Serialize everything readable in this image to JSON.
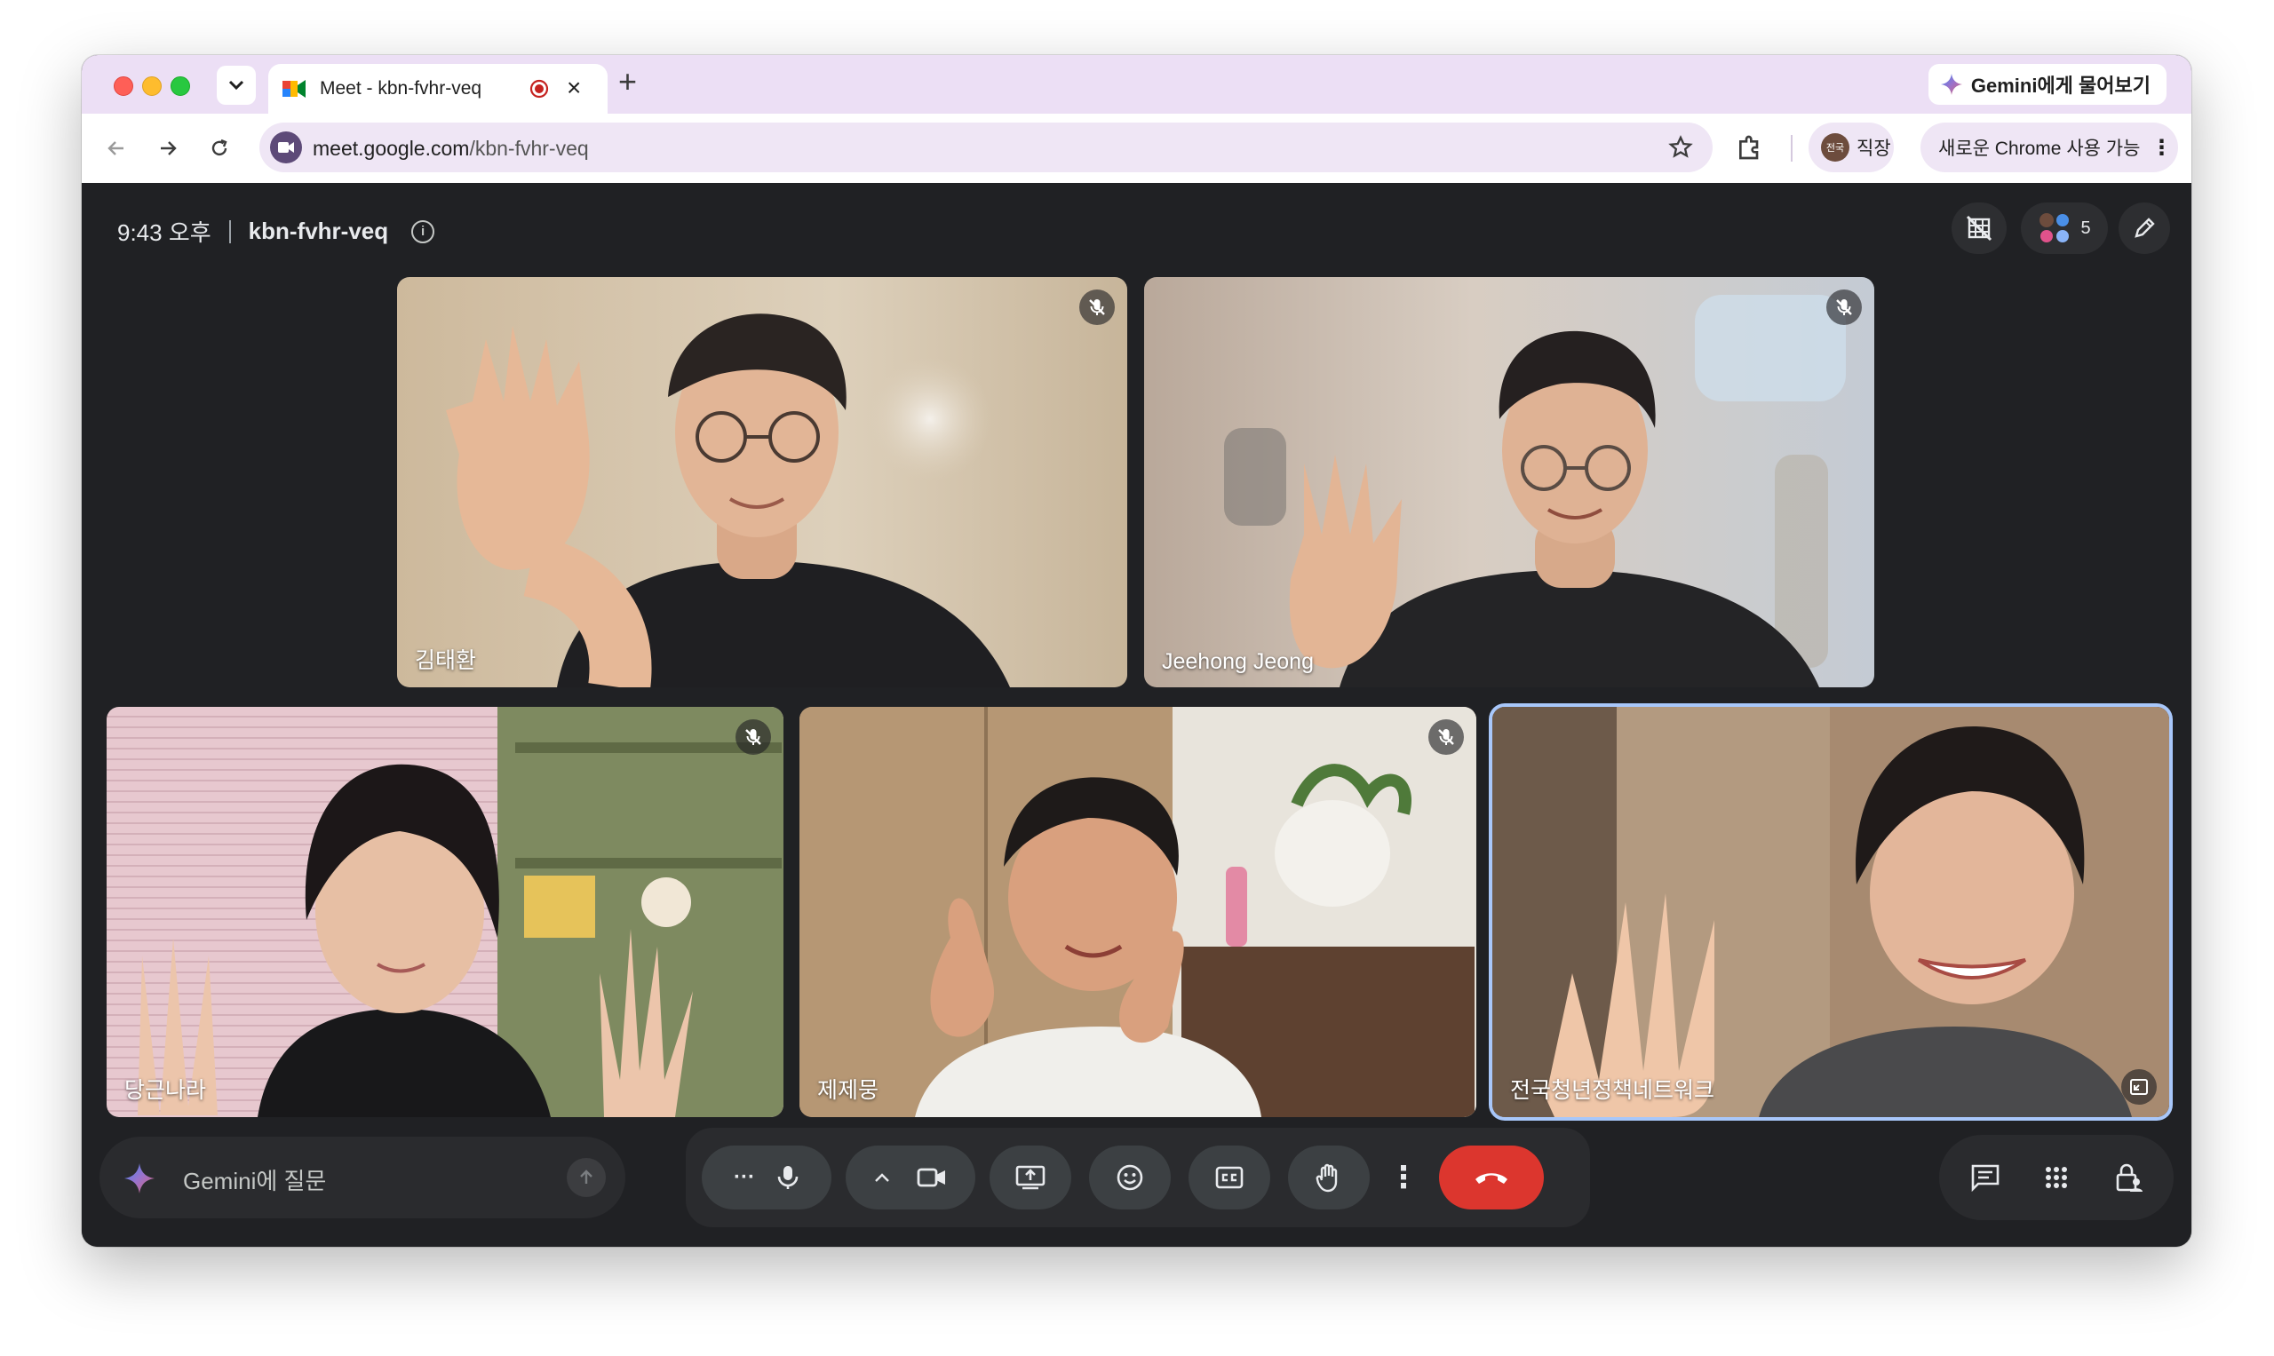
{
  "browser": {
    "tab_title": "Meet - kbn-fvhr-veq",
    "gemini_chip_label": "Gemini에게 물어보기",
    "url_host": "meet.google.com",
    "url_path": "/kbn-fvhr-veq",
    "profile_label": "직장",
    "profile_avatar_text": "전국",
    "update_label": "새로운 Chrome 사용 가능"
  },
  "meet": {
    "time": "9:43 오후",
    "meeting_code": "kbn-fvhr-veq",
    "participant_count": "5",
    "participants": [
      {
        "name": "김태환",
        "muted": true
      },
      {
        "name": "Jeehong Jeong",
        "muted": true
      },
      {
        "name": "당근나라",
        "muted": true
      },
      {
        "name": "제제뭉",
        "muted": true
      },
      {
        "name": "전국청년정책네트워크",
        "muted": false,
        "active_speaker": true
      }
    ],
    "gemini_prompt_placeholder": "Gemini에 질문",
    "colors": {
      "background": "#202124",
      "end_call": "#dc362e",
      "active_border": "#a8c7fa",
      "tabstrip": "#ecdff5"
    }
  }
}
